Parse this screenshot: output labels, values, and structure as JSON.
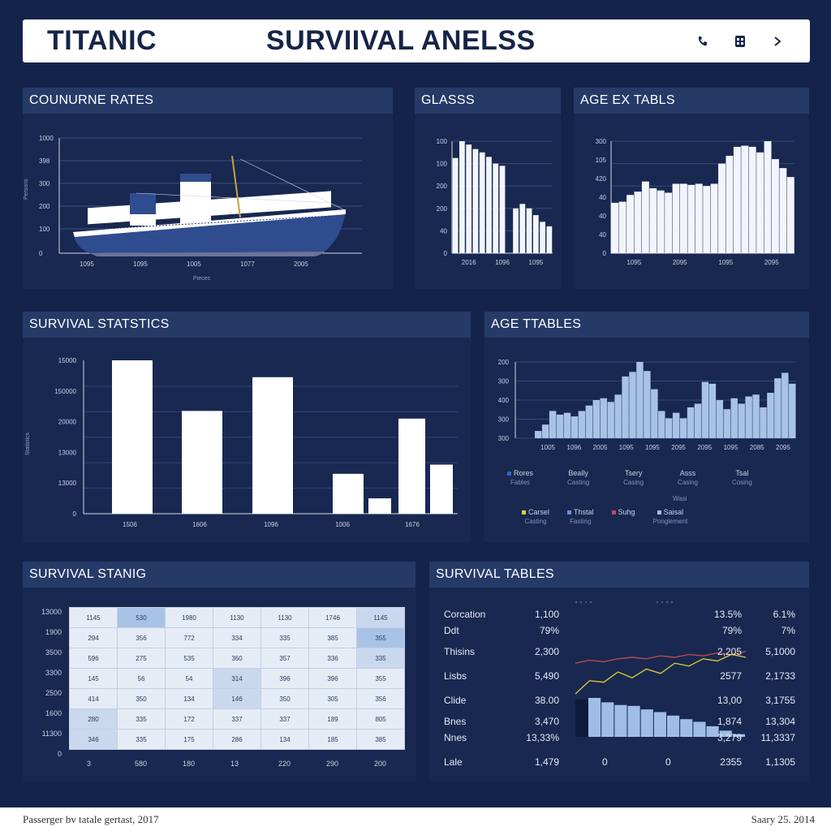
{
  "header": {
    "brand": "TITANIC",
    "title": "SURVIIVAL ANELSS",
    "icons": [
      "phone-icon",
      "grid-icon",
      "chevron-right-icon"
    ]
  },
  "panels": {
    "coun": "COUNURNE RATES",
    "glass": "GLASSS",
    "ageex": "AGE EX TABLS",
    "surv": "SURVIVAL STATSTICS",
    "agetables": "AGE TTABLES",
    "standing": "SURVIVAL STANIG",
    "survtables": "SURVIVAL TABLES"
  },
  "chart_data": [
    {
      "type": "line",
      "panel": "COUNURNE RATES",
      "yticks": [
        "100",
        "200",
        "300",
        "398",
        "1000"
      ],
      "xticks": [
        "1095",
        "1095",
        "1005",
        "1077",
        "2005"
      ],
      "ylabel": "Persons",
      "xlabel": "Pieces",
      "grid": true,
      "note": "illustration of ship drawn over the grid"
    },
    {
      "type": "bar",
      "panel": "GLASSS",
      "yticks": [
        "40",
        "200",
        "200",
        "100",
        "100"
      ],
      "xticks": [
        "2016",
        "1096",
        "1095"
      ],
      "values": [
        85,
        100,
        97,
        93,
        90,
        86,
        80,
        78,
        0,
        40,
        44,
        40,
        34,
        28,
        24
      ]
    },
    {
      "type": "bar",
      "panel": "AGE EX TABLS",
      "yticks": [
        "40",
        "40",
        "40",
        "420",
        "105",
        "300"
      ],
      "xticks": [
        "1095",
        "2095",
        "1095",
        "2095"
      ],
      "values": [
        45,
        46,
        52,
        55,
        64,
        58,
        56,
        54,
        62,
        62,
        61,
        62,
        60,
        62,
        80,
        87,
        95,
        96,
        95,
        90,
        100,
        84,
        76,
        68
      ]
    },
    {
      "type": "bar",
      "panel": "SURVIVAL STATSTICS",
      "yticks": [
        "0",
        "13000",
        "13000",
        "20000",
        "150000",
        "15000"
      ],
      "xticks": [
        "1506",
        "1606",
        "1096",
        "1006",
        "1676"
      ],
      "ylabel": "Statistics",
      "values": [
        100,
        67,
        89,
        26,
        10,
        62,
        32
      ]
    },
    {
      "type": "bar",
      "panel": "AGE TTABLES",
      "yticks": [
        "300",
        "300",
        "400",
        "300",
        "200"
      ],
      "xticks": [
        "1005",
        "1096",
        "2005",
        "1095",
        "1095",
        "2095",
        "2095",
        "1095",
        "2085",
        "2095"
      ],
      "values": [
        8,
        15,
        30,
        26,
        28,
        24,
        30,
        36,
        42,
        44,
        40,
        48,
        68,
        73,
        84,
        74,
        54,
        30,
        22,
        28,
        22,
        34,
        38,
        62,
        60,
        42,
        32,
        44,
        38,
        46,
        48,
        34,
        50,
        66,
        72,
        60
      ]
    },
    {
      "type": "table",
      "panel": "SURVIVAL STANIG",
      "yticks": [
        "0",
        "11300",
        "1600",
        "2500",
        "3300",
        "3500",
        "1900",
        "13000"
      ],
      "xticks": [
        "3",
        "580",
        "180",
        "13",
        "220",
        "290",
        "200"
      ],
      "rows": [
        [
          "1145",
          "530",
          "1980",
          "1130",
          "1130",
          "1746",
          "1145"
        ],
        [
          "294",
          "356",
          "772",
          "334",
          "335",
          "385",
          "355"
        ],
        [
          "596",
          "275",
          "535",
          "360",
          "357",
          "336",
          "335"
        ],
        [
          "145",
          "56",
          "54",
          "314",
          "396",
          "396",
          "355"
        ],
        [
          "414",
          "350",
          "134",
          "146",
          "350",
          "305",
          "356"
        ],
        [
          "280",
          "335",
          "172",
          "337",
          "337",
          "189",
          "805"
        ],
        [
          "346",
          "335",
          "175",
          "286",
          "134",
          "185",
          "385"
        ]
      ]
    },
    {
      "type": "line",
      "panel": "SURVIVAL TABLES",
      "series": [
        {
          "values": [
            10,
            28,
            26,
            40,
            32,
            44,
            38,
            52,
            48,
            58,
            55,
            64,
            60
          ]
        },
        {
          "values": [
            52,
            56,
            54,
            58,
            60,
            58,
            62,
            60,
            64,
            62,
            66,
            64,
            68
          ]
        }
      ],
      "bars": [
        88,
        78,
        72,
        70,
        62,
        56,
        48,
        40,
        34,
        24,
        14,
        6
      ]
    }
  ],
  "legend_top": [
    {
      "label": "Rores",
      "sub": "Fables",
      "color": "#2f63c8"
    },
    {
      "label": "Beally",
      "sub": "Casting",
      "color": ""
    },
    {
      "label": "Tsery",
      "sub": "Casing",
      "color": ""
    },
    {
      "label": "Asss",
      "sub": "Casing",
      "color": ""
    },
    {
      "label": "Tsal",
      "sub": "Cosing",
      "color": ""
    }
  ],
  "legend_mid": "Wasi",
  "legend_bottom": [
    {
      "label": "Carsel",
      "sub": "Casting",
      "color": "#e4d23a"
    },
    {
      "label": "Thstal",
      "sub": "Fasting",
      "color": "#6d8fe0"
    },
    {
      "label": "Suhg",
      "sub": "",
      "color": "#c04c54"
    },
    {
      "label": "Saisal",
      "sub": "Ponglement",
      "color": "#9fbde8"
    }
  ],
  "stats": [
    {
      "label": "Corcation",
      "v1": "1,100",
      "v2": "",
      "v3": "13.5%",
      "v4": "6.1%"
    },
    {
      "label": "Ddt",
      "v1": "79%",
      "v2": "",
      "v3": "79%",
      "v4": "7%"
    },
    {
      "label": "Thisins",
      "v1": "2,300",
      "v2": "",
      "v3": "2,205",
      "v4": "5,1000"
    },
    {
      "label": "Lisbs",
      "v1": "5,490",
      "v2": "",
      "v3": "2577",
      "v4": "2,1733"
    },
    {
      "label": "Clide",
      "v1": "38.00",
      "v2": "",
      "v3": "13,00",
      "v4": "3,1755"
    },
    {
      "label": "Bnes",
      "v1": "3,470",
      "v2": "",
      "v3": "1,874",
      "v4": "13,304"
    },
    {
      "label": "Nnes",
      "v1": "13,33%",
      "v2": "",
      "v3": "3,279",
      "v4": "11,3337"
    },
    {
      "label": "Lale",
      "v1": "1,479",
      "v2": "0",
      "v2b": "0",
      "v3": "2355",
      "v4": "1,1305"
    }
  ],
  "footer": {
    "left": "Passerger bv tatale gertast, 2017",
    "right": "Saary 25. 2014"
  },
  "colors": {
    "background": "#14234a",
    "panel": "#182850",
    "panel_header": "#263a68",
    "bar": "#ffffff",
    "bar_light": "#a9c3e6",
    "line_yellow": "#d6c23a",
    "line_red": "#b84a4a"
  }
}
